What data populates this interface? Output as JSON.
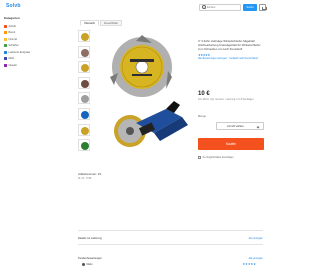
{
  "header": {
    "logo": "Solvb",
    "search_placeholder": "Suchen",
    "search_button": "Suche"
  },
  "sidebar": {
    "title": "Kategorien",
    "items": [
      {
        "label": "Anhalt",
        "color": "#f4511e"
      },
      {
        "label": "Bereit",
        "color": "#ff9800"
      },
      {
        "label": "Normal",
        "color": "#fbc02d"
      },
      {
        "label": "Schärfen",
        "color": "#43a047"
      },
      {
        "label": "Lackierte Entgrater",
        "color": "#1e88e5"
      },
      {
        "label": "Multi",
        "color": "#3949ab"
      },
      {
        "label": "Glasalt",
        "color": "#8e24aa"
      }
    ]
  },
  "gallery": {
    "tabs": [
      "Übersicht",
      "Zusatzbilder"
    ],
    "thumb_colors": [
      "#c9a227",
      "#8d6e63",
      "#c9a227",
      "#6d4c41",
      "#9e9e9e",
      "#1565c0",
      "#c9a227",
      "#2e7d32"
    ]
  },
  "product": {
    "title": "4\" 3 Zahn Holzsäge Winkelschleifer-Sägeblatt Holzbearbeitung Kreissägeblatt für Winkelschleifer zum Schneiden von Holz Kunststoff",
    "stars": "★★★★★",
    "rating_text": "Alle Bewertungen anzeigen · Verkauft nach Deutschland",
    "price": "10 €",
    "vat": "inkl. MwSt. zzgl. Versand · Lieferung in 5–8 Werktagen",
    "quantity_label": "Menge",
    "quantity_value": "Anzahl wählen",
    "buy_button": "Kaufen",
    "compare_label": "Zu Vergleichsliste hinzufügen"
  },
  "sections": {
    "item_no_title": "Artikelnummer: 1/1",
    "item_no_sub": "St. Nr.: 7746",
    "delivery_title": "Details zur Lieferung",
    "delivery_link": "Alle anzeigen",
    "reviews_title": "Kundenbewertungen",
    "reviews_link": "Alle anzeigen",
    "review_stars": "★★★★★",
    "review_name": "Mario"
  }
}
